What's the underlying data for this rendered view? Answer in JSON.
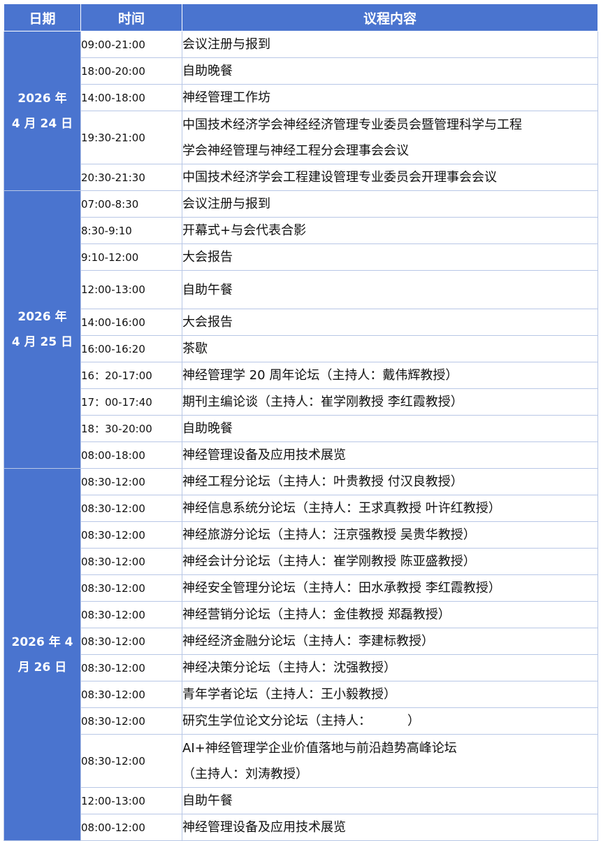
{
  "header": {
    "date": "日期",
    "time": "时间",
    "content": "议程内容"
  },
  "days": [
    {
      "date_line1": "2026 年",
      "date_line2": "4 月 24 日",
      "items": [
        {
          "time": "09:00-21:00",
          "content": "会议注册与报到"
        },
        {
          "time": "18:00-20:00",
          "content": "自助晚餐"
        },
        {
          "time": "14:00-18:00",
          "content": "神经管理工作坊"
        },
        {
          "time": "19:30-21:00",
          "content_line1": "中国技术经济学会神经经济管理专业委员会暨管理科学与工程",
          "content_line2": "学会神经管理与神经工程分会理事会会议"
        },
        {
          "time": "20:30-21:30",
          "content": "中国技术经济学会工程建设管理专业委员会开理事会会议"
        }
      ]
    },
    {
      "date_line1": "2026 年",
      "date_line2": "4 月 25 日",
      "items": [
        {
          "time": "07:00-8:30",
          "content": "会议注册与报到"
        },
        {
          "time": "8:30-9:10",
          "content": "开幕式+与会代表合影"
        },
        {
          "time": "9:10-12:00",
          "content": "大会报告"
        },
        {
          "time": "12:00-13:00",
          "content": "自助午餐"
        },
        {
          "time": "14:00-16:00",
          "content": "大会报告"
        },
        {
          "time": "16:00-16:20",
          "content": "茶歇"
        },
        {
          "time": "16：20-17:00",
          "content": "神经管理学 20 周年论坛（主持人：戴伟辉教授）"
        },
        {
          "time": "17：00-17:40",
          "content": "期刊主编论谈（主持人：崔学刚教授 李红霞教授）"
        },
        {
          "time": "18：30-20:00",
          "content": "自助晚餐"
        },
        {
          "time": "08:00-18:00",
          "content": "神经管理设备及应用技术展览"
        }
      ]
    },
    {
      "date_line1": "2026 年 4",
      "date_line2": "月 26 日",
      "items": [
        {
          "time": "08:30-12:00",
          "content": "神经工程分论坛（主持人：叶贵教授 付汉良教授）"
        },
        {
          "time": "08:30-12:00",
          "content": "神经信息系统分论坛（主持人：王求真教授 叶许红教授）"
        },
        {
          "time": "08:30-12:00",
          "content": "神经旅游分论坛（主持人：汪京强教授 吴贵华教授）"
        },
        {
          "time": "08:30-12:00",
          "content": "神经会计分论坛（主持人：崔学刚教授 陈亚盛教授）"
        },
        {
          "time": "08:30-12:00",
          "content": "神经安全管理分论坛（主持人：田水承教授 李红霞教授）"
        },
        {
          "time": "08:30-12:00",
          "content": "神经营销分论坛（主持人：金佳教授 郑磊教授）"
        },
        {
          "time": "08:30-12:00",
          "content": "神经经济金融分论坛（主持人：李建标教授）"
        },
        {
          "time": "08:30-12:00",
          "content": "神经决策分论坛（主持人：沈强教授）"
        },
        {
          "time": "08:30-12:00",
          "content": "青年学者论坛（主持人：王小毅教授）"
        },
        {
          "time": "08:30-12:00",
          "content_a": "研究生学位论文分论坛（主持人：",
          "content_b": "）"
        },
        {
          "time": "08:30-12:00",
          "content_line1": "AI+神经管理学企业价值落地与前沿趋势高峰论坛",
          "content_line2": "（主持人：刘涛教授）"
        },
        {
          "time": "12:00-13:00",
          "content": "自助午餐"
        },
        {
          "time": "08:00-12:00",
          "content": "神经管理设备及应用技术展览"
        }
      ]
    }
  ]
}
